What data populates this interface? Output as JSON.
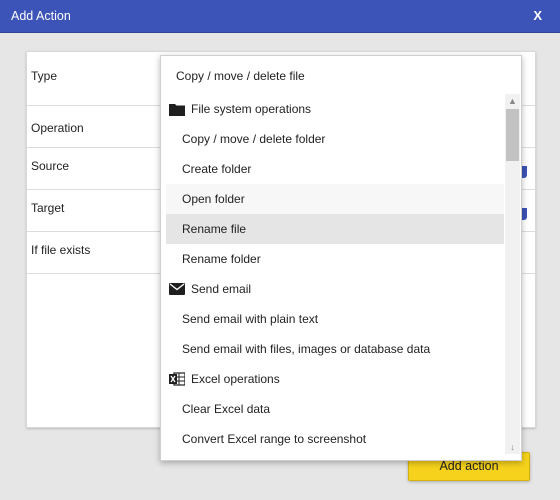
{
  "window": {
    "title": "Add Action",
    "close_label": "X"
  },
  "form": {
    "rows": [
      {
        "label": "Type"
      },
      {
        "label": "Operation"
      },
      {
        "label": "Source"
      },
      {
        "label": "Target"
      },
      {
        "label": "If file exists"
      }
    ]
  },
  "add_button": {
    "label": "Add action"
  },
  "dropdown": {
    "selected": "Copy / move / delete file",
    "items": [
      {
        "kind": "group",
        "icon": "folder-icon",
        "label": "File system operations"
      },
      {
        "kind": "option",
        "label": "Copy / move / delete folder"
      },
      {
        "kind": "option",
        "label": "Create folder"
      },
      {
        "kind": "option",
        "label": "Open folder"
      },
      {
        "kind": "option",
        "label": "Rename file",
        "hovered": true
      },
      {
        "kind": "option",
        "label": "Rename folder"
      },
      {
        "kind": "group",
        "icon": "envelope-icon",
        "label": "Send email"
      },
      {
        "kind": "option",
        "label": "Send email with plain text"
      },
      {
        "kind": "option",
        "label": "Send email with files, images or database data"
      },
      {
        "kind": "group",
        "icon": "excel-icon",
        "label": "Excel operations"
      },
      {
        "kind": "option",
        "label": "Clear Excel data"
      },
      {
        "kind": "option",
        "label": "Convert Excel range to screenshot"
      }
    ]
  },
  "colors": {
    "titlebar": "#3c54b8",
    "accent_button": "#f6d21c",
    "hover_row": "#e5e5e5"
  }
}
